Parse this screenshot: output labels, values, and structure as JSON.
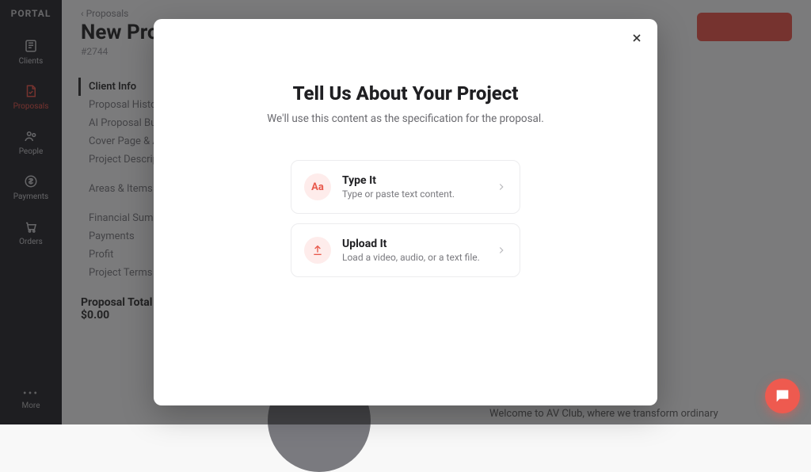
{
  "brand": "PORTAL",
  "rail": {
    "items": [
      {
        "label": "Clients",
        "icon": "clients"
      },
      {
        "label": "Proposals",
        "icon": "proposals",
        "active": true
      },
      {
        "label": "People",
        "icon": "people"
      },
      {
        "label": "Payments",
        "icon": "payments"
      },
      {
        "label": "Orders",
        "icon": "orders"
      }
    ],
    "more_label": "More"
  },
  "page": {
    "breadcrumb": "Proposals",
    "title": "New Proposal",
    "proposal_id": "#2744",
    "nav": [
      {
        "label": "Client Info",
        "active": true
      },
      {
        "label": "Proposal History"
      },
      {
        "label": "AI Proposal Builder"
      },
      {
        "label": "Cover Page & About Us"
      },
      {
        "label": "Project Description"
      },
      {
        "spacer": true
      },
      {
        "label": "Areas & Items"
      },
      {
        "spacer": true
      },
      {
        "label": "Financial Summary"
      },
      {
        "label": "Payments"
      },
      {
        "label": "Profit"
      },
      {
        "label": "Project Terms"
      }
    ],
    "total_label": "Proposal Total",
    "total_value": "$0.00",
    "blurb": "Welcome to AV Club, where we transform ordinary"
  },
  "modal": {
    "title": "Tell Us About Your Project",
    "subtitle": "We'll use this content as the specification for the proposal.",
    "choices": [
      {
        "key": "type",
        "title": "Type It",
        "desc": "Type or paste text content.",
        "icon": "Aa"
      },
      {
        "key": "upload",
        "title": "Upload It",
        "desc": "Load a video, audio, or a text file.",
        "icon": "upload"
      }
    ]
  }
}
